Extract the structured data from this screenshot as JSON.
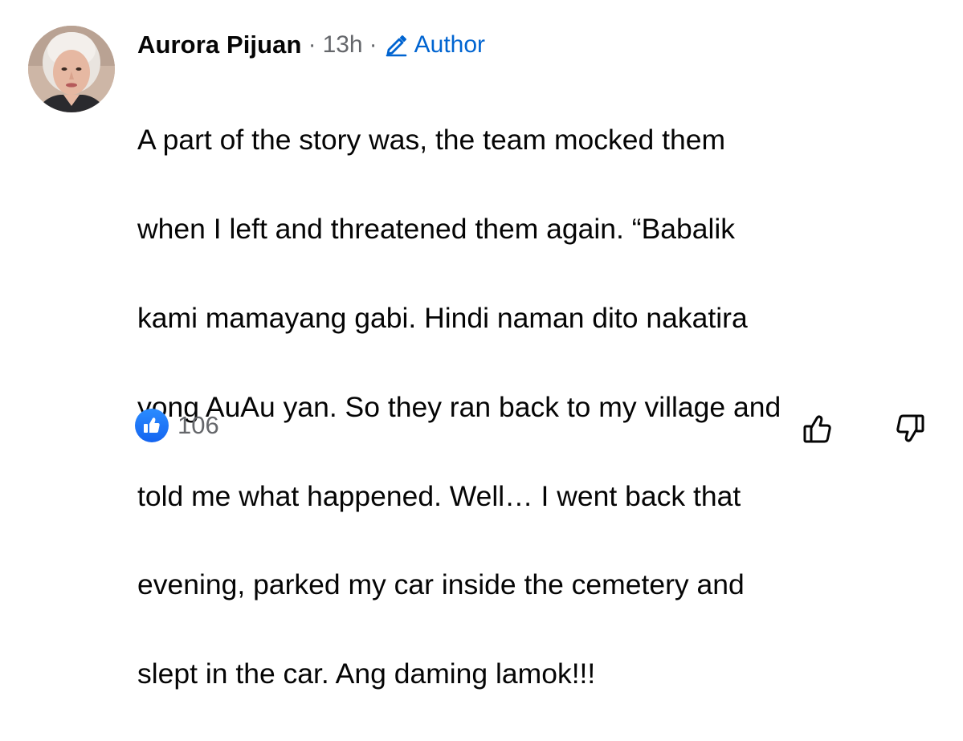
{
  "comment": {
    "author": "Aurora Pijuan",
    "separator": "·",
    "timestamp": "13h",
    "badge_label": "Author",
    "badge_icon": "pencil-icon",
    "avatar_icon": "avatar-photo",
    "body_lines": [
      "A part of the story was, the team mocked them",
      "when I left and threatened them again. “Babalik",
      "kami mamayang gabi. Hindi naman dito nakatira",
      "yong AuAu yan. So they ran back to my village and",
      "told me what happened.  Well… I went back that",
      "evening, parked my car inside the cemetery and",
      "slept in the car.  Ang daming lamok!!!"
    ]
  },
  "reactions": {
    "icon": "like-icon",
    "count": "106",
    "upvote_icon": "thumbs-up-outline-icon",
    "downvote_icon": "thumbs-down-outline-icon"
  },
  "colors": {
    "text": "#050505",
    "secondary": "#65676b",
    "link_blue": "#0064d1",
    "like_blue": "#1877f2"
  }
}
